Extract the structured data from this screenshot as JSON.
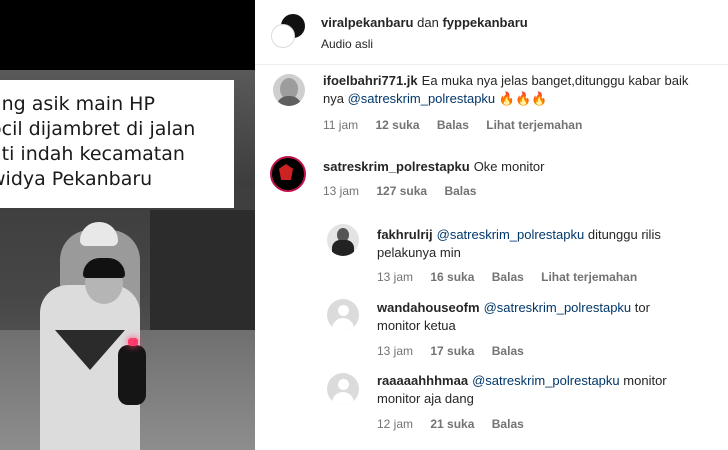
{
  "media": {
    "caption_lines": [
      "ang asik main HP",
      "ocil dijambret di jalan",
      "ati indah kecamatan",
      "widya Pekanbaru"
    ]
  },
  "header": {
    "user1": "viralpekanbaru",
    "conjunction": "dan",
    "user2": "fyppekanbaru",
    "audio": "Audio asli"
  },
  "comments": [
    {
      "user": "ifoelbahri771.jk",
      "text_line1": "Ea muka nya jelas banget,ditunggu kabar baik",
      "text_line2_prefix": "nya ",
      "mention": "@satreskrim_polrestapku",
      "emoji": "🔥🔥🔥",
      "time": "11 jam",
      "likes": "12 suka",
      "reply": "Balas",
      "translate": "Lihat terjemahan",
      "avatar_icon": "face-photo-avatar"
    },
    {
      "user": "satreskrim_polrestapku",
      "text": "Oke monitor",
      "time": "13 jam",
      "likes": "127 suka",
      "reply": "Balas",
      "avatar_icon": "police-logo-avatar"
    },
    {
      "user": "fakhrulrij",
      "mention": "@satreskrim_polrestapku",
      "text_after": "ditunggu rilis",
      "text_line2": "pelakunya min",
      "time": "13 jam",
      "likes": "16 suka",
      "reply": "Balas",
      "translate": "Lihat terjemahan",
      "avatar_icon": "suit-photo-avatar"
    },
    {
      "user": "wandahouseofm",
      "mention": "@satreskrim_polrestapku",
      "text_after": "tor",
      "text_line2": "monitor ketua",
      "time": "13 jam",
      "likes": "17 suka",
      "reply": "Balas",
      "avatar_icon": "default-user-avatar"
    },
    {
      "user": "raaaaahhhmaa",
      "mention": "@satreskrim_polrestapku",
      "text_after": "monitor",
      "text_line2": "monitor aja dang",
      "time": "12 jam",
      "likes": "21 suka",
      "reply": "Balas",
      "avatar_icon": "default-user-avatar"
    }
  ],
  "colors": {
    "mention": "#00376b",
    "meta": "#737373",
    "text": "#262626"
  }
}
